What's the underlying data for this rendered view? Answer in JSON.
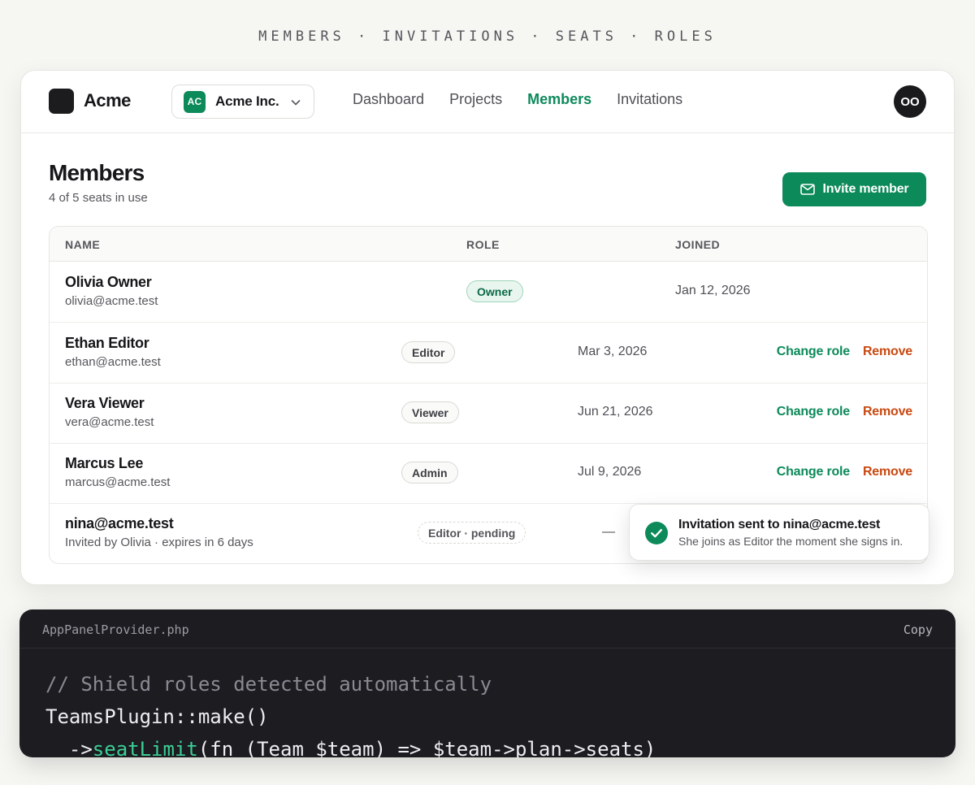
{
  "eyebrow": "MEMBERS · INVITATIONS · SEATS · ROLES",
  "app": {
    "name": "Acme"
  },
  "team_switcher": {
    "initials": "AC",
    "name": "Acme Inc."
  },
  "nav": {
    "links": [
      "Dashboard",
      "Projects",
      "Members",
      "Invitations"
    ],
    "active": "Members"
  },
  "user": {
    "initials": "OO"
  },
  "page": {
    "title": "Members",
    "seats": "4 of 5 seats in use",
    "invite_label": "Invite member"
  },
  "table": {
    "headers": {
      "name": "NAME",
      "role": "ROLE",
      "joined": "JOINED"
    },
    "actions": {
      "change_role": "Change role",
      "remove": "Remove"
    },
    "rows": [
      {
        "name": "Olivia Owner",
        "email": "olivia@acme.test",
        "role": "Owner",
        "joined": "Jan 12, 2026"
      },
      {
        "name": "Ethan Editor",
        "email": "ethan@acme.test",
        "role": "Editor",
        "joined": "Mar 3, 2026"
      },
      {
        "name": "Vera Viewer",
        "email": "vera@acme.test",
        "role": "Viewer",
        "joined": "Jun 21, 2026"
      },
      {
        "name": "Marcus Lee",
        "email": "marcus@acme.test",
        "role": "Admin",
        "joined": "Jul 9, 2026"
      },
      {
        "name": "nina@acme.test",
        "email": "Invited by Olivia · expires in 6 days",
        "role": "Editor · pending",
        "joined": "—"
      }
    ]
  },
  "toast": {
    "title": "Invitation sent to nina@acme.test",
    "body": "She joins as Editor the moment she signs in."
  },
  "code": {
    "filename": "AppPanelProvider.php",
    "copy_label": "Copy",
    "comment": "// Shield roles detected automatically",
    "line2": "TeamsPlugin::make()",
    "line3_prefix": "  ->",
    "line3_method": "seatLimit",
    "line3_rest": "(fn (Team $team) => $team->plan->seats)"
  },
  "colors": {
    "accent": "#0d8a5a",
    "danger": "#c84a12",
    "code_bg": "#1c1c21"
  }
}
